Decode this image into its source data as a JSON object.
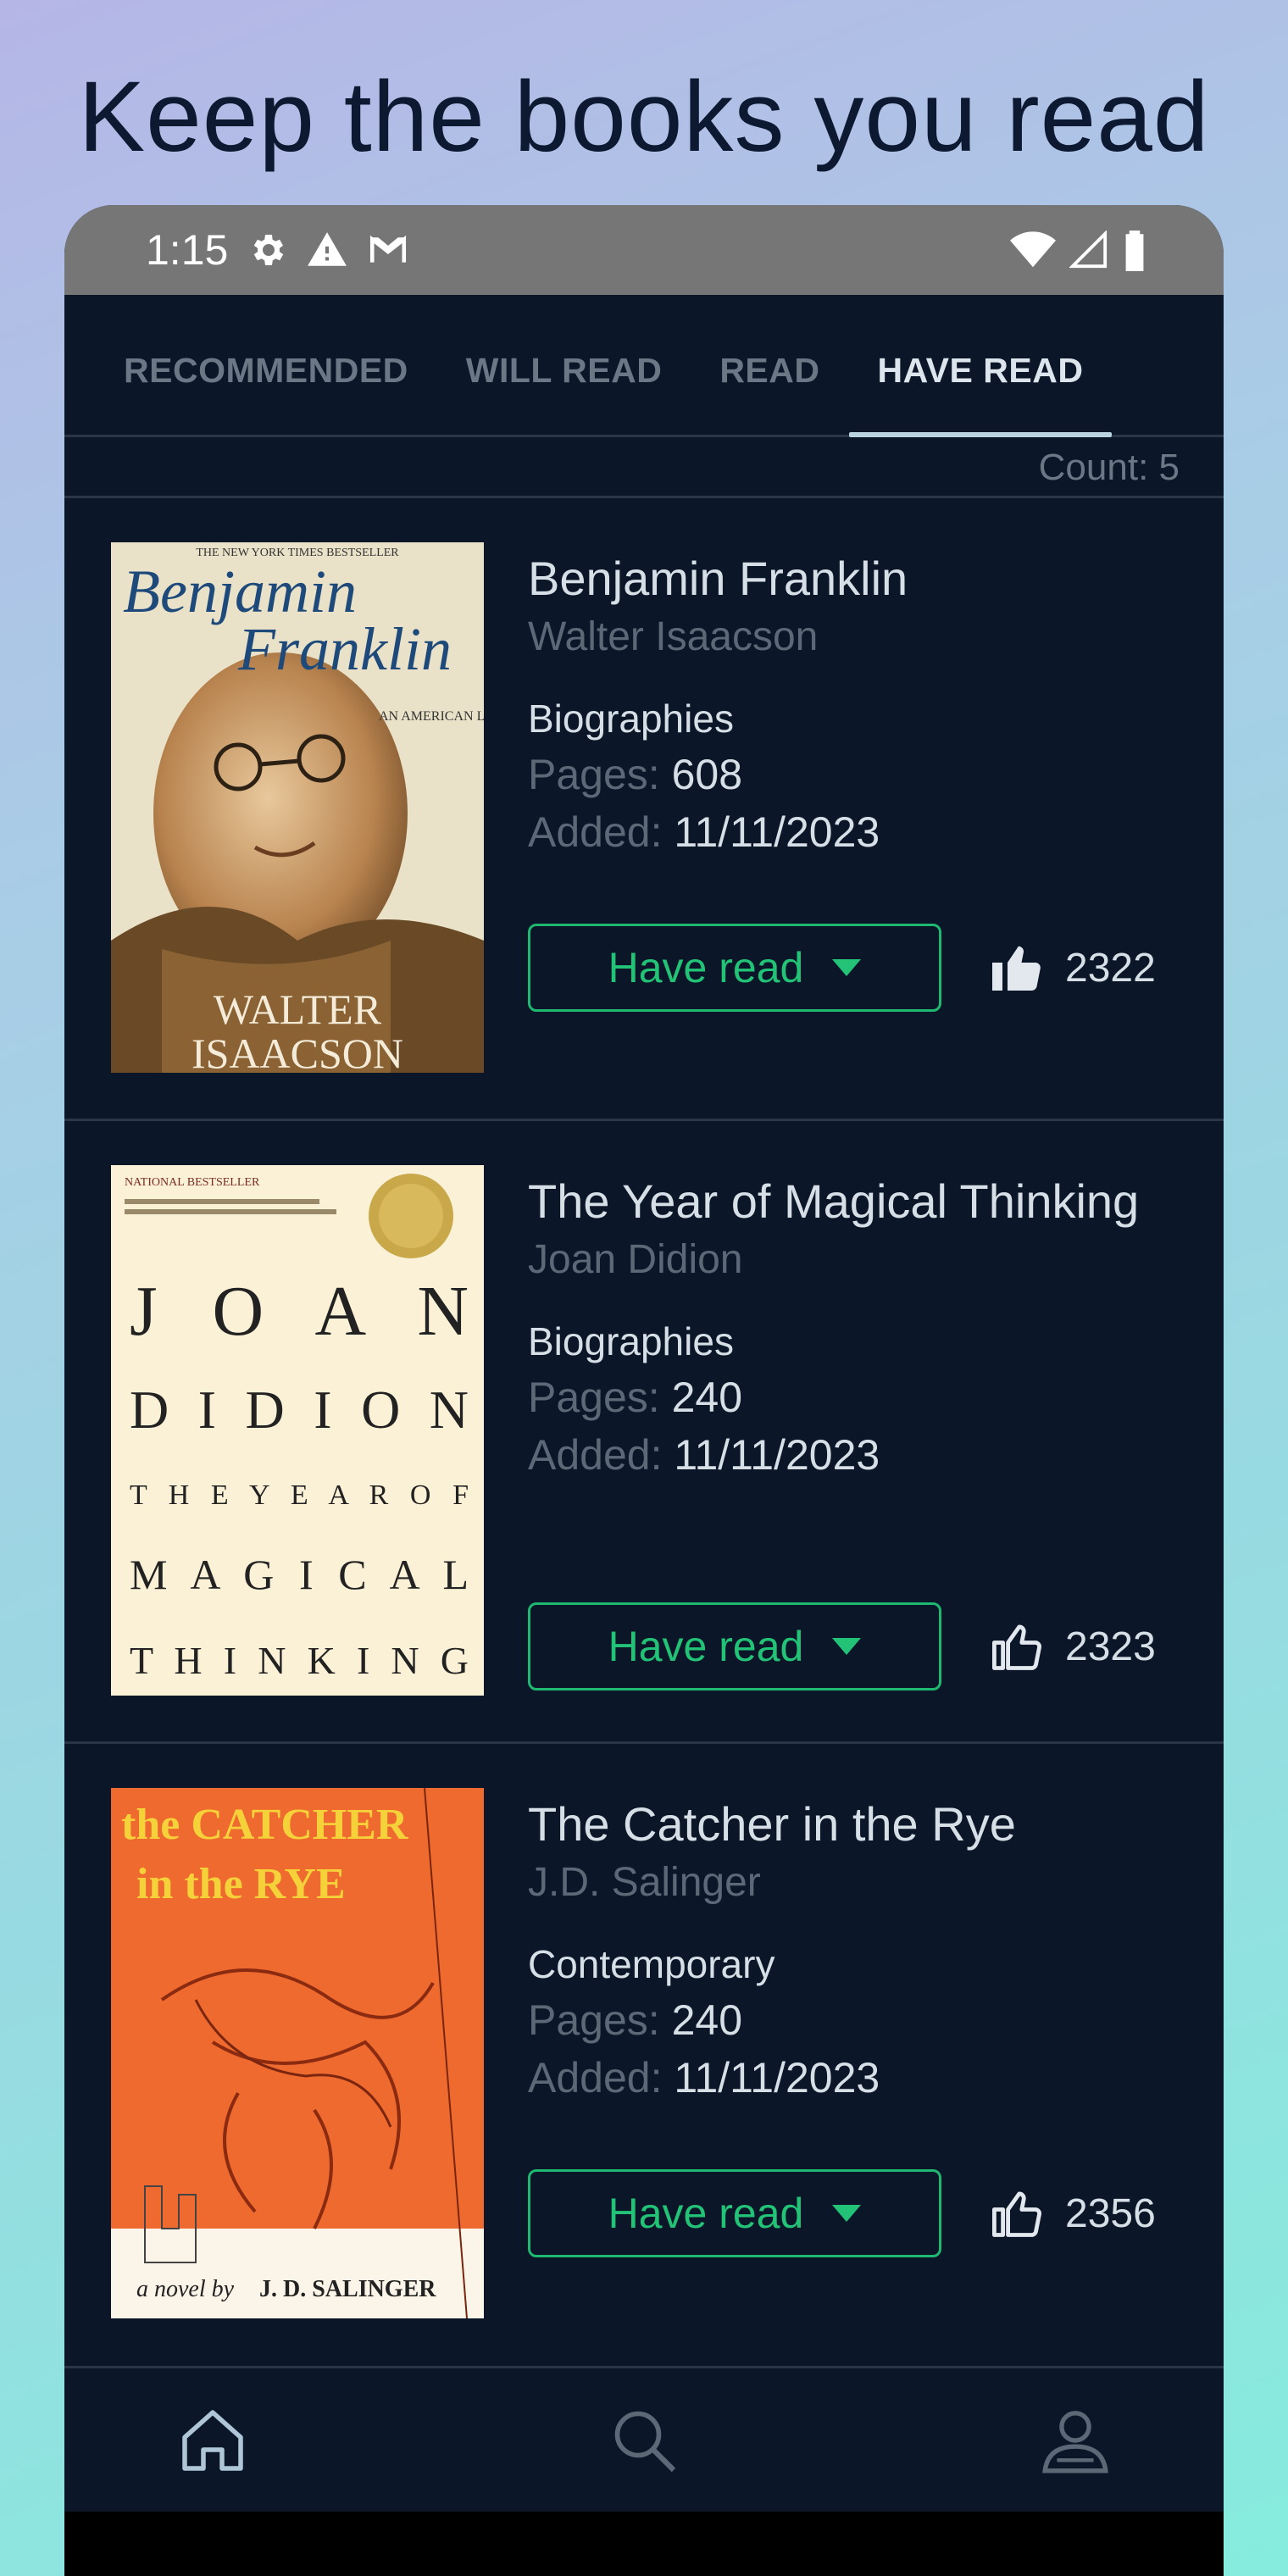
{
  "headline": "Keep the books you read",
  "status_bar": {
    "time": "1:15",
    "icons": [
      "settings-icon",
      "warning-icon",
      "gmail-icon",
      "wifi-icon",
      "signal-icon",
      "battery-icon"
    ]
  },
  "tabs": [
    "RECOMMENDED",
    "WILL READ",
    "READ",
    "HAVE READ"
  ],
  "active_tab": "HAVE READ",
  "count_label": "Count: 5",
  "books": [
    {
      "title": "Benjamin Franklin",
      "author": "Walter Isaacson",
      "genre": "Biographies",
      "pages_label": "Pages:",
      "pages": "608",
      "added_label": "Added:",
      "added": "11/11/2023",
      "status": "Have read",
      "likes": "2322",
      "liked": true,
      "cover_text": {
        "top": "THE NEW YORK TIMES BESTSELLER",
        "t1": "Benjamin",
        "t2": "Franklin",
        "sub": "AN AMERICAN LIFE",
        "a1": "WALTER",
        "a2": "ISAACSON"
      }
    },
    {
      "title": "The Year of Magical Thinking",
      "author": "Joan Didion",
      "genre": "Biographies",
      "pages_label": "Pages:",
      "pages": "240",
      "added_label": "Added:",
      "added": "11/11/2023",
      "status": "Have read",
      "likes": "2323",
      "liked": false,
      "cover_text": {
        "top": "NATIONAL BESTSELLER",
        "l1": "J O A N",
        "l2": "D I D I O N",
        "l3": "T H E   Y E A R   O F",
        "l4": "M A G I C A L",
        "l5": "T H I N K I N G"
      }
    },
    {
      "title": "The Catcher in the Rye",
      "author": "J.D. Salinger",
      "genre": "Contemporary",
      "pages_label": "Pages:",
      "pages": "240",
      "added_label": "Added:",
      "added": "11/11/2023",
      "status": "Have read",
      "likes": "2356",
      "liked": false,
      "cover_text": {
        "t1": "the CATCHER",
        "t2": "in the RYE",
        "by": "a novel by",
        "author": "J. D. SALINGER"
      }
    }
  ],
  "bottom_nav": [
    "home-icon",
    "search-icon",
    "profile-icon"
  ],
  "colors": {
    "accent": "#23c377",
    "background": "#0b1729",
    "tab_indicator": "#b9d3e0"
  }
}
